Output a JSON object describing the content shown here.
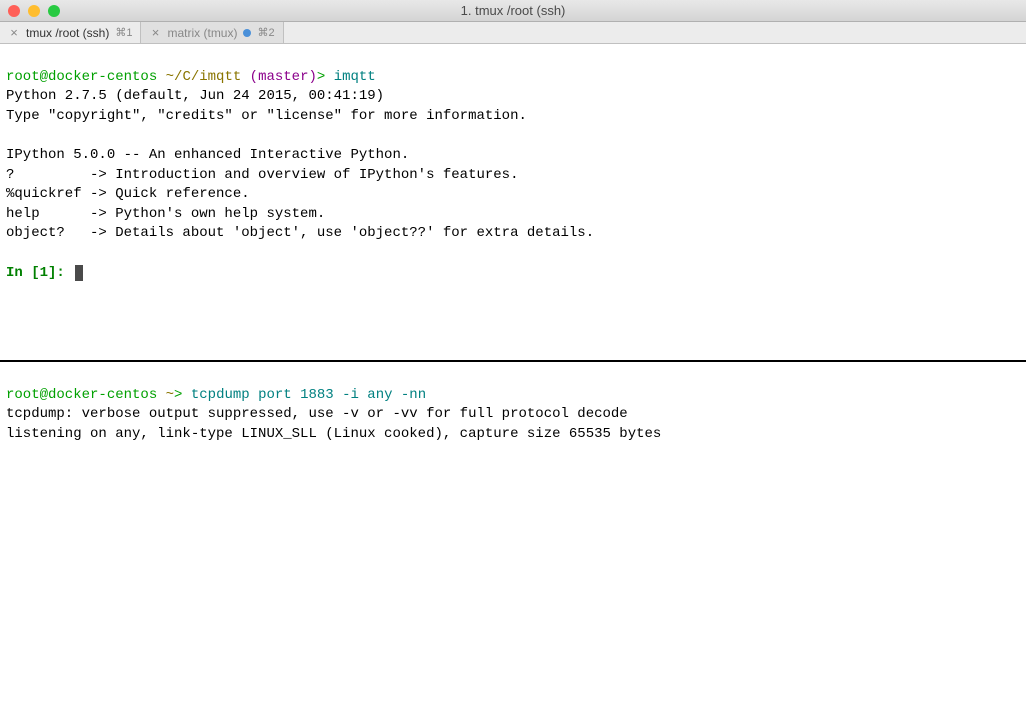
{
  "titlebar": {
    "title": "1. tmux  /root (ssh)"
  },
  "tabs": [
    {
      "label": "tmux /root (ssh)",
      "shortcut": "⌘1",
      "active": true
    },
    {
      "label": "matrix (tmux)",
      "shortcut": "⌘2",
      "active": false,
      "dot": true
    }
  ],
  "pane_top": {
    "prompt_user": "root@docker-centos",
    "prompt_path": "~/C/imqtt",
    "prompt_branch": "(master)",
    "prompt_sep": ">",
    "command": "imqtt",
    "lines": [
      "Python 2.7.5 (default, Jun 24 2015, 00:41:19)",
      "Type \"copyright\", \"credits\" or \"license\" for more information.",
      "",
      "IPython 5.0.0 -- An enhanced Interactive Python.",
      "?         -> Introduction and overview of IPython's features.",
      "%quickref -> Quick reference.",
      "help      -> Python's own help system.",
      "object?   -> Details about 'object', use 'object??' for extra details."
    ],
    "ipython_in": "In [",
    "ipython_num": "1",
    "ipython_close": "]: "
  },
  "pane_bottom": {
    "prompt_user": "root@docker-centos",
    "prompt_path": "~",
    "prompt_sep": ">",
    "command": "tcpdump port 1883 -i any -nn",
    "lines": [
      "tcpdump: verbose output suppressed, use -v or -vv for full protocol decode",
      "listening on any, link-type LINUX_SLL (Linux cooked), capture size 65535 bytes"
    ]
  }
}
